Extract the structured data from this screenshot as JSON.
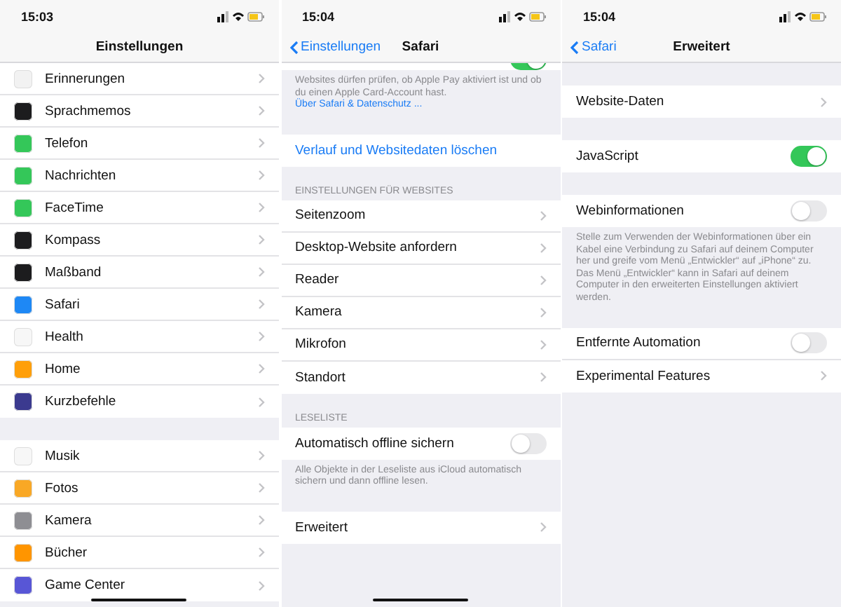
{
  "panels": [
    {
      "time": "15:03",
      "title": "Einstellungen",
      "home_indicator": true,
      "sections": [
        {
          "rows": [
            {
              "kind": "nav",
              "label": "Erinnerungen",
              "color": "#f2f2f2"
            },
            {
              "kind": "nav",
              "label": "Sprachmemos",
              "color": "#1c1c1e"
            },
            {
              "kind": "nav",
              "label": "Telefon",
              "color": "#34c759"
            },
            {
              "kind": "nav",
              "label": "Nachrichten",
              "color": "#34c759"
            },
            {
              "kind": "nav",
              "label": "FaceTime",
              "color": "#34c759"
            },
            {
              "kind": "nav",
              "label": "Kompass",
              "color": "#1c1c1e"
            },
            {
              "kind": "nav",
              "label": "Maßband",
              "color": "#1c1c1e"
            },
            {
              "kind": "nav",
              "label": "Safari",
              "color": "#1e88f5"
            },
            {
              "kind": "nav",
              "label": "Health",
              "color": "#f7f7f7"
            },
            {
              "kind": "nav",
              "label": "Home",
              "color": "#ff9f0a"
            },
            {
              "kind": "nav",
              "label": "Kurzbefehle",
              "color": "#3b3a8f"
            }
          ]
        },
        {
          "rows": [
            {
              "kind": "nav",
              "label": "Musik",
              "color": "#f7f7f7"
            },
            {
              "kind": "nav",
              "label": "Fotos",
              "color": "#f9a825"
            },
            {
              "kind": "nav",
              "label": "Kamera",
              "color": "#8e8e93"
            },
            {
              "kind": "nav",
              "label": "Bücher",
              "color": "#ff9500"
            },
            {
              "kind": "nav",
              "label": "Game Center",
              "color": "#5856d6"
            }
          ]
        }
      ]
    },
    {
      "time": "15:04",
      "back": "Einstellungen",
      "title": "Safari",
      "home_indicator": true,
      "sections": [
        {
          "rows": [
            {
              "kind": "cut_toggle",
              "on": true
            }
          ],
          "footer": {
            "text": "Websites dürfen prüfen, ob Apple Pay aktiviert ist und ob du einen Apple Card-Account hast.",
            "link": "Über Safari & Datenschutz ..."
          }
        },
        {
          "rows": [
            {
              "kind": "action",
              "label": "Verlauf und Websitedaten löschen"
            }
          ]
        },
        {
          "header": "EINSTELLUNGEN FÜR WEBSITES",
          "rows": [
            {
              "kind": "nav",
              "label": "Seitenzoom"
            },
            {
              "kind": "nav",
              "label": "Desktop-Website anfordern"
            },
            {
              "kind": "nav",
              "label": "Reader"
            },
            {
              "kind": "nav",
              "label": "Kamera"
            },
            {
              "kind": "nav",
              "label": "Mikrofon"
            },
            {
              "kind": "nav",
              "label": "Standort"
            }
          ]
        },
        {
          "header": "LESELISTE",
          "rows": [
            {
              "kind": "toggle",
              "label": "Automatisch offline sichern",
              "on": false
            }
          ],
          "footer": {
            "text": "Alle Objekte in der Leseliste aus iCloud automatisch sichern und dann offline lesen."
          }
        },
        {
          "rows": [
            {
              "kind": "nav",
              "label": "Erweitert"
            }
          ]
        }
      ]
    },
    {
      "time": "15:04",
      "back": "Safari",
      "title": "Erweitert",
      "home_indicator": false,
      "sections": [
        {
          "rows": [
            {
              "kind": "nav",
              "label": "Website-Daten"
            }
          ]
        },
        {
          "rows": [
            {
              "kind": "toggle",
              "label": "JavaScript",
              "on": true
            }
          ]
        },
        {
          "rows": [
            {
              "kind": "toggle",
              "label": "Webinformationen",
              "on": false
            }
          ],
          "footer": {
            "text": "Stelle zum Verwenden der Webinformationen über ein Kabel eine Verbindung zu Safari auf deinem Computer her und greife vom Menü „Entwickler“ auf „iPhone“ zu. Das Menü „Entwickler“ kann in Safari auf deinem Computer in den erweiterten Einstellungen aktiviert werden."
          }
        },
        {
          "rows": [
            {
              "kind": "toggle",
              "label": "Entfernte Automation",
              "on": false
            },
            {
              "kind": "nav",
              "label": "Experimental Features"
            }
          ]
        }
      ]
    }
  ]
}
